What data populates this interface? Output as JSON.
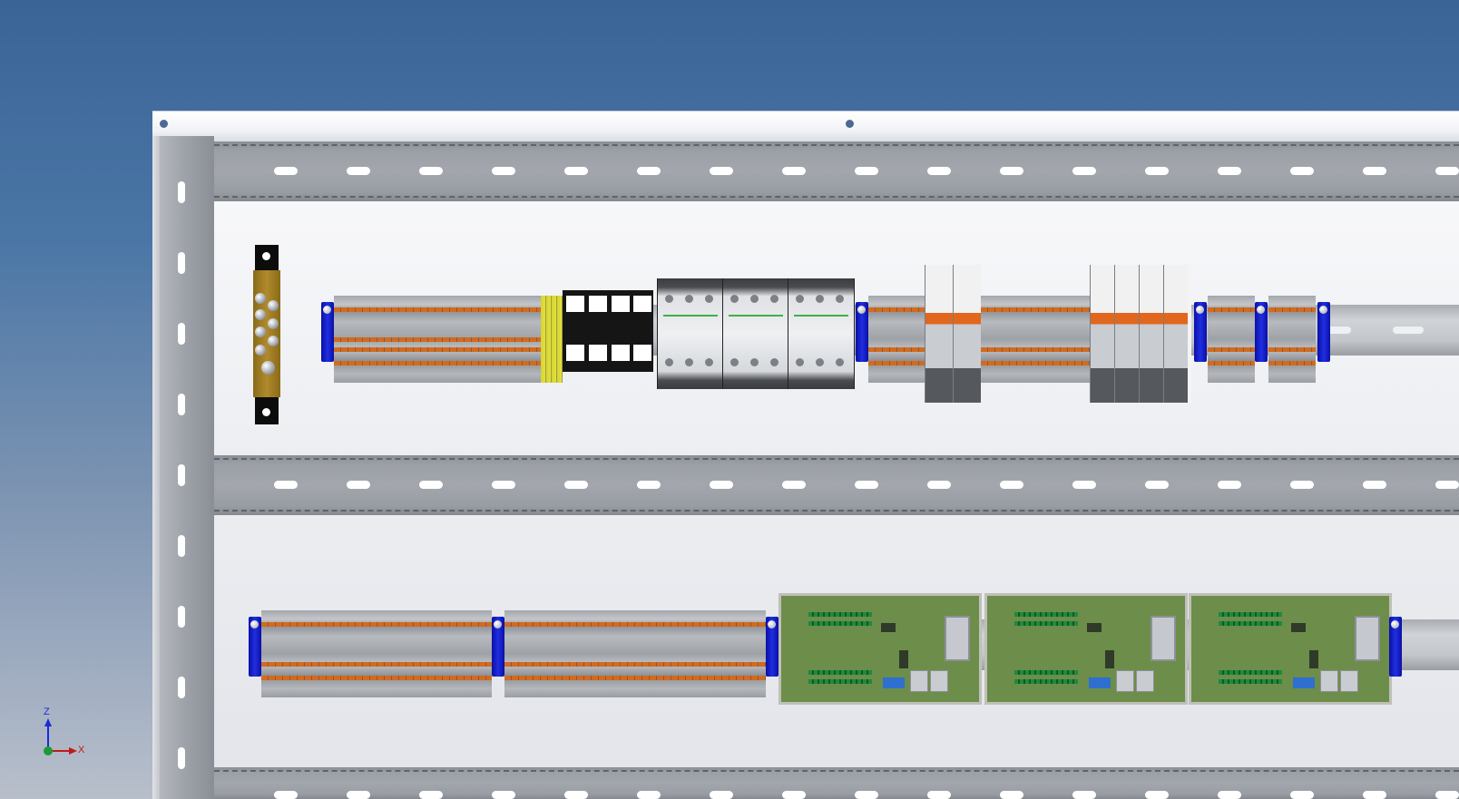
{
  "viewport": {
    "background_top": "#3a6496",
    "background_bottom": "#b8bfcb"
  },
  "colors": {
    "rail_steel": "#9b9fa6",
    "din_rail": "#c3c6ca",
    "terminal_orange": "#d36b1e",
    "end_stop_blue": "#1f2ee0",
    "pcb_green": "#6d8d4a",
    "relay_orange": "#e2661e",
    "busbar_brass": "#b08a2c",
    "pe_yellow": "#e4e040"
  },
  "components": {
    "ground_busbar": "busbar-icon",
    "terminal_block": "terminal-block-icon",
    "fuse_holder": "fuse-holder-icon",
    "contactor": "contactor-icon",
    "relay": "relay-icon",
    "io_board": "pcb-icon",
    "end_stop": "end-stop-icon"
  },
  "triad": {
    "z_label": "Z",
    "x_label": "X",
    "z_color": "#1a2bd6",
    "x_color": "#c41818",
    "origin_color": "#1e9a34"
  }
}
